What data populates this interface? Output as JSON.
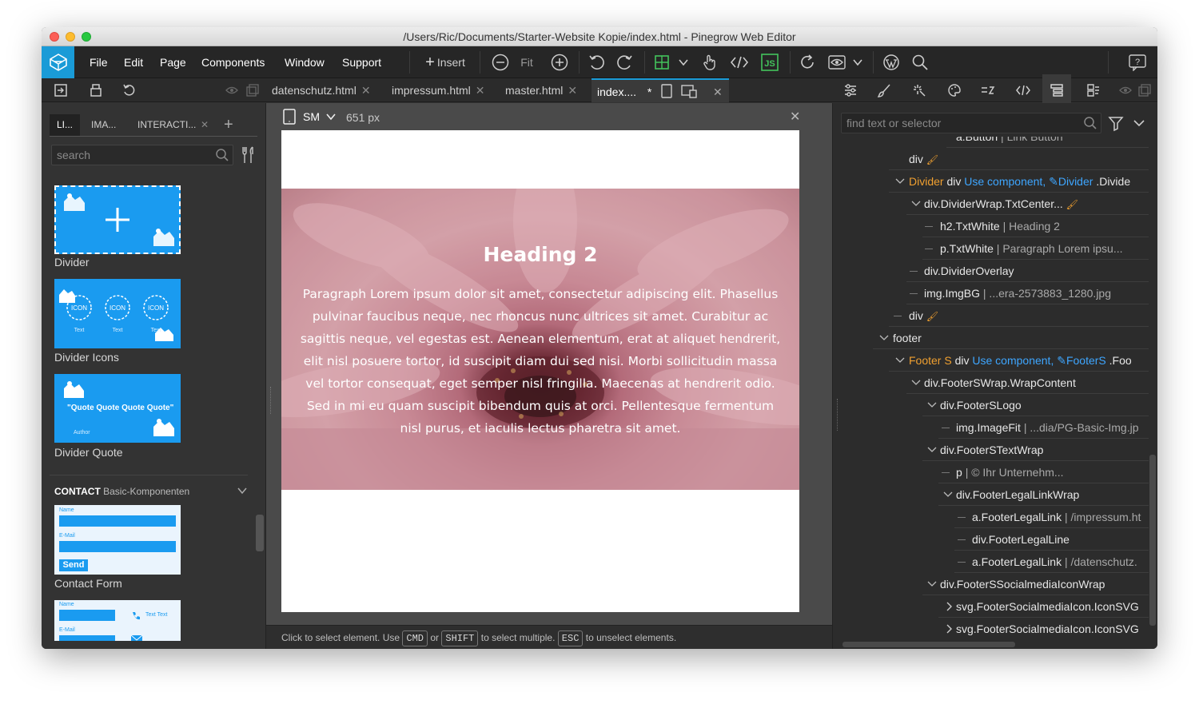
{
  "window": {
    "title": "/Users/Ric/Documents/Starter-Website Kopie/index.html - Pinegrow Web Editor"
  },
  "menu": {
    "items": [
      "File",
      "Edit",
      "Page",
      "Components",
      "Window",
      "Support"
    ],
    "insert_label": "Insert",
    "fit_label": "Fit",
    "help_label": "?"
  },
  "doc_tabs": [
    {
      "label": "datenschutz.html"
    },
    {
      "label": "impressum.html"
    },
    {
      "label": "master.html"
    },
    {
      "label": "index....",
      "modified": "*",
      "active": true
    }
  ],
  "library": {
    "tabs": [
      "LI...",
      "IMA...",
      "INTERACTI..."
    ],
    "search_placeholder": "search",
    "items": [
      {
        "label": "Divider",
        "icon": "divider-thumb"
      },
      {
        "label": "Divider Icons",
        "icon": "divider-icons-thumb",
        "icon_text": "ICON",
        "text": "Text"
      },
      {
        "label": "Divider Quote",
        "icon": "divider-quote-thumb",
        "quote": "\"Quote Quote Quote Quote\"",
        "author": "Author"
      }
    ],
    "section_title": "CONTACT",
    "section_subtitle": "Basic-Komponenten",
    "contact_items": [
      {
        "label": "Contact Form",
        "field1": "Name",
        "field2": "E-Mail",
        "button": "Send"
      },
      {
        "field1": "Name",
        "field2": "E-Mail",
        "side_text": "Text Text"
      }
    ]
  },
  "canvas": {
    "device": "SM",
    "width_label": "651 px",
    "hero_heading": "Heading 2",
    "hero_paragraph": "Paragraph Lorem ipsum dolor sit amet, consectetur adipiscing elit. Phasellus pulvinar faucibus neque, nec rhoncus nunc ultrices sit amet. Curabitur ac sagittis neque, vel egestas est. Aenean elementum, erat at aliquet hendrerit, elit nisl posuere tortor, id suscipit diam dui sed nisi. Morbi sollicitudin massa vel tortor consequat, eget semper nisl fringilla. Maecenas at hendrerit odio. Sed in mi eu quam suscipit bibendum quis at orci. Pellentesque fermentum nisl purus, et iaculis lectus pharetra sit amet."
  },
  "status": {
    "part1": "Click to select element. Use",
    "key1": "CMD",
    "part2": "or",
    "key2": "SHIFT",
    "part3": "to select multiple.",
    "key3": "ESC",
    "part4": "to unselect elements."
  },
  "tree": {
    "search_placeholder": "find text or selector",
    "rows": [
      {
        "name": "a.Button",
        "meta": "| Link Button"
      },
      {
        "name": "div"
      },
      {
        "comp": "Divider",
        "name": "div",
        "link": "Use component,",
        "link2": "Divider",
        "tail": ".Divide"
      },
      {
        "name": "div.DividerWrap.TxtCenter..."
      },
      {
        "name": "h2.TxtWhite",
        "meta": "| Heading 2"
      },
      {
        "name": "p.TxtWhite",
        "meta": "| Paragraph Lorem ipsu..."
      },
      {
        "name": "div.DividerOverlay"
      },
      {
        "name": "img.ImgBG",
        "meta": "| ...era-2573883_1280.jpg"
      },
      {
        "name": "div"
      },
      {
        "name": "footer"
      },
      {
        "comp": "Footer S",
        "name": "div",
        "link": "Use component,",
        "link2": "FooterS",
        "tail": ".Foo"
      },
      {
        "name": "div.FooterSWrap.WrapContent"
      },
      {
        "name": "div.FooterSLogo"
      },
      {
        "name": "img.ImageFit",
        "meta": "| ...dia/PG-Basic-Img.jp"
      },
      {
        "name": "div.FooterSTextWrap"
      },
      {
        "name": "p",
        "meta": "| © Ihr Unternehm..."
      },
      {
        "name": "div.FooterLegalLinkWrap"
      },
      {
        "name": "a.FooterLegalLink",
        "meta": "| /impressum.ht"
      },
      {
        "name": "div.FooterLegalLine"
      },
      {
        "name": "a.FooterLegalLink",
        "meta": "| /datenschutz."
      },
      {
        "name": "div.FooterSSocialmediaIconWrap"
      },
      {
        "name": "svg.FooterSocialmediaIcon.IconSVG"
      },
      {
        "name": "svg.FooterSocialmediaIcon.IconSVG"
      }
    ]
  },
  "colors": {
    "accent": "#1a9bd7",
    "component": "#f0a030",
    "link": "#3ea6ff",
    "js_badge": "#43c35c"
  }
}
